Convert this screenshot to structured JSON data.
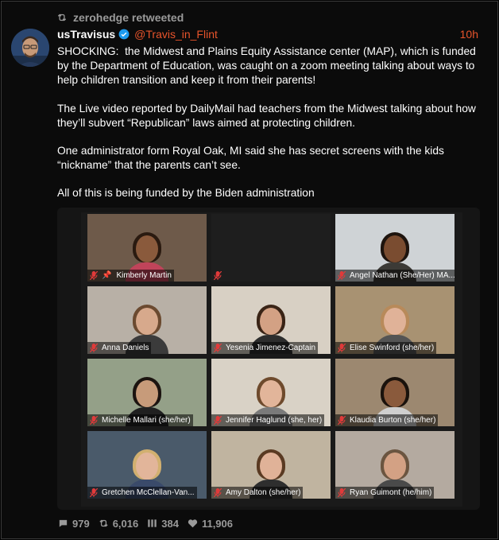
{
  "retweet": {
    "by": "zerohedge retweeted"
  },
  "author": {
    "name": "usTravisus",
    "handle": "@Travis_in_Flint",
    "time": "10h"
  },
  "tweet": {
    "paragraphs": [
      "SHOCKING:  the Midwest and Plains Equity Assistance center (MAP), which is funded by the Department of Education, was caught on a zoom meeting talking about ways to help children transition and keep it from their parents!",
      "The Live video reported by DailyMail had teachers from the Midwest talking about how they’ll subvert “Republican” laws aimed at protecting children.",
      "One administrator form Royal Oak, MI said she has secret screens with the kids “nickname” that the parents can’t see.",
      "All of this is being funded by the Biden administration"
    ]
  },
  "participants": [
    {
      "label": "Kimberly Martin",
      "pinned": true,
      "bg": "#6e5a4a",
      "skin": "#8a5a3c",
      "hair": "#2a1a10",
      "shirt": "#c0445a"
    },
    {
      "label": "",
      "empty": true
    },
    {
      "label": "Angel Nathan (She/Her) MA...",
      "highlighted": true,
      "bg": "#cfd3d6",
      "skin": "#7a4c30",
      "hair": "#1e140e",
      "shirt": "#3c3a36"
    },
    {
      "label": "Anna Daniels",
      "bg": "#b8b0a6",
      "skin": "#d7a98c",
      "hair": "#6b4a30",
      "shirt": "#3b3b3b"
    },
    {
      "label": "Yesenia Jimenez-Captain",
      "bg": "#d8d0c4",
      "skin": "#d3a184",
      "hair": "#3a2416",
      "shirt": "#2d2d2d"
    },
    {
      "label": "Elise Swinford (she/her)",
      "bg": "#a89272",
      "skin": "#e0b298",
      "hair": "#b88a5a",
      "shirt": "#545454"
    },
    {
      "label": "Michelle Mallari (she/her)",
      "bg": "#94a088",
      "skin": "#c79b7a",
      "hair": "#1c1410",
      "shirt": "#202020"
    },
    {
      "label": "Jennifer Haglund (she, her)",
      "bg": "#d9d2c6",
      "skin": "#e2b59a",
      "hair": "#6e4a2c",
      "shirt": "#7a7a7a"
    },
    {
      "label": "Klaudia Burton (she/her)",
      "bg": "#9c8870",
      "skin": "#8a5a3c",
      "hair": "#1a120c",
      "shirt": "#cfcfcf"
    },
    {
      "label": "Gretchen McClellan-Van...",
      "bg": "#4a5a6a",
      "skin": "#e2b59a",
      "hair": "#d2b070",
      "shirt": "#3a4a6a"
    },
    {
      "label": "Amy Dalton (she/her)",
      "bg": "#c0b4a0",
      "skin": "#e0b298",
      "hair": "#5a3a22",
      "shirt": "#2e2e2e"
    },
    {
      "label": "Ryan Guimont (he/him)",
      "bg": "#b4aaa0",
      "skin": "#d3a184",
      "hair": "#6b5540",
      "shirt": "#4a4a4a"
    }
  ],
  "stats": {
    "replies": "979",
    "retweets": "6,016",
    "quotes": "384",
    "likes": "11,906"
  },
  "colors": {
    "accent": "#e8542b",
    "highlight": "#d3e07a",
    "muted": "#9a9a9a"
  }
}
